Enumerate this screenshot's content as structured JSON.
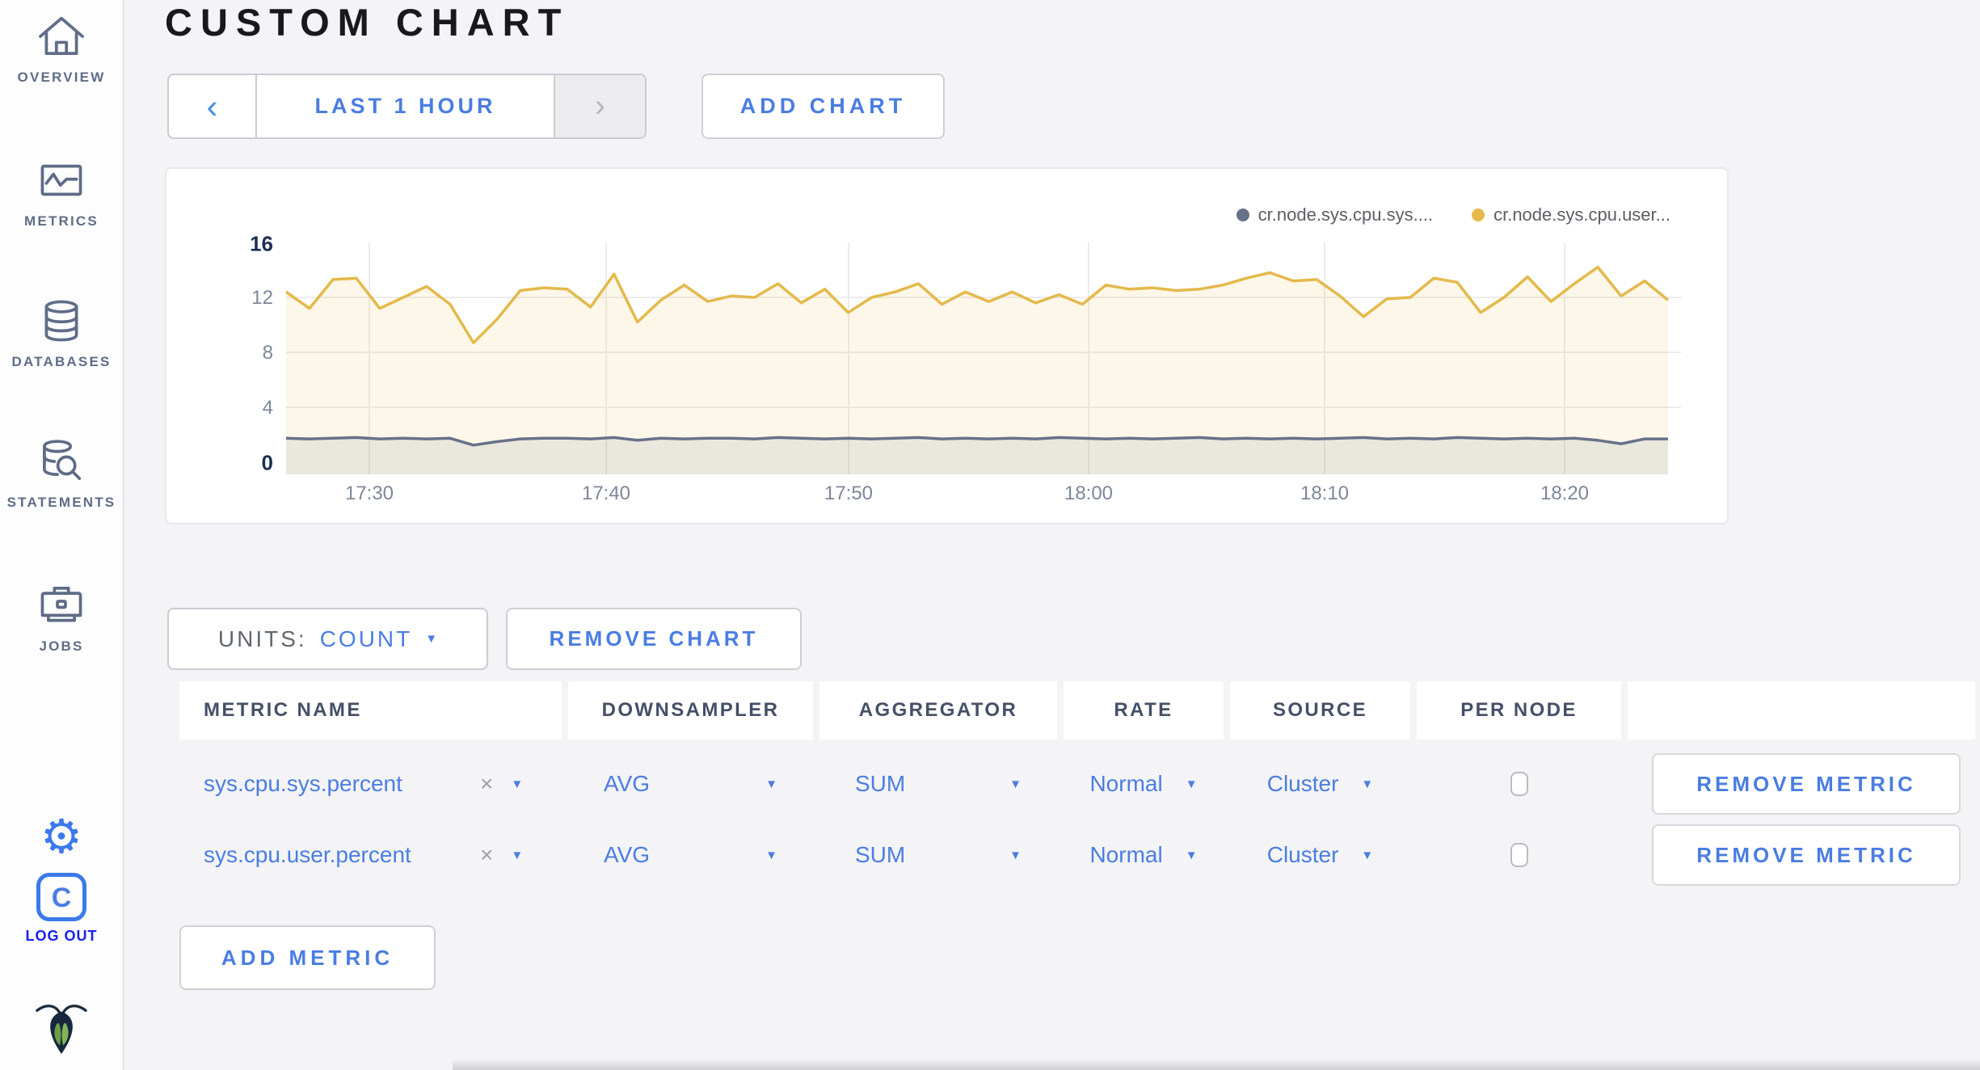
{
  "header": {
    "title": "CUSTOM CHART"
  },
  "icons": {
    "chevron_left": "‹",
    "chevron_right": "›",
    "caret_down": "▼",
    "remove_x": "×",
    "gear": "⚙",
    "logout_letter": "C"
  },
  "sidebar": {
    "items": [
      {
        "label": "OVERVIEW"
      },
      {
        "label": "METRICS"
      },
      {
        "label": "DATABASES"
      },
      {
        "label": "STATEMENTS"
      },
      {
        "label": "JOBS"
      }
    ],
    "logout_label": "LOG OUT"
  },
  "toolbar": {
    "time_window": "LAST 1 HOUR",
    "add_chart": "ADD CHART"
  },
  "chart_data": {
    "type": "area",
    "title": "",
    "grid": true,
    "legend_position": "top-right",
    "ylim": [
      0,
      16
    ],
    "y_ticks": [
      0,
      4,
      8,
      12,
      16
    ],
    "x_ticks": [
      "17:30",
      "17:40",
      "17:50",
      "18:00",
      "18:10",
      "18:20"
    ],
    "series": [
      {
        "name": "cr.node.sys.cpu.sys....",
        "color": "#66718a",
        "fill": "rgba(108,118,137,0.12)",
        "values": [
          1.75,
          1.7,
          1.75,
          1.8,
          1.7,
          1.75,
          1.7,
          1.75,
          1.25,
          1.5,
          1.7,
          1.75,
          1.75,
          1.7,
          1.8,
          1.6,
          1.75,
          1.7,
          1.75,
          1.75,
          1.7,
          1.8,
          1.75,
          1.7,
          1.75,
          1.7,
          1.75,
          1.8,
          1.7,
          1.75,
          1.7,
          1.75,
          1.7,
          1.8,
          1.75,
          1.7,
          1.75,
          1.7,
          1.75,
          1.8,
          1.7,
          1.75,
          1.7,
          1.75,
          1.7,
          1.75,
          1.8,
          1.7,
          1.75,
          1.7,
          1.8,
          1.75,
          1.7,
          1.75,
          1.7,
          1.75,
          1.6,
          1.35,
          1.7,
          1.7
        ]
      },
      {
        "name": "cr.node.sys.cpu.user...",
        "color": "#e4b94b",
        "fill": "rgba(232,192,80,0.13)",
        "values": [
          12.4,
          11.2,
          13.3,
          13.4,
          11.2,
          12.0,
          12.8,
          11.5,
          8.7,
          10.4,
          12.5,
          12.7,
          12.6,
          11.3,
          13.7,
          10.2,
          11.8,
          12.9,
          11.7,
          12.1,
          12.0,
          13.0,
          11.6,
          12.6,
          10.9,
          12.0,
          12.4,
          13.0,
          11.5,
          12.4,
          11.7,
          12.4,
          11.6,
          12.2,
          11.5,
          12.9,
          12.6,
          12.7,
          12.5,
          12.6,
          12.9,
          13.4,
          13.8,
          13.2,
          13.3,
          12.1,
          10.6,
          11.9,
          12.0,
          13.4,
          13.1,
          10.9,
          12.0,
          13.5,
          11.7,
          13.0,
          14.2,
          12.1,
          13.2,
          11.8
        ]
      }
    ]
  },
  "chart_controls": {
    "units_label": "UNITS:",
    "units_value": "COUNT",
    "remove_chart": "REMOVE CHART"
  },
  "metrics_table": {
    "columns": [
      "METRIC NAME",
      "DOWNSAMPLER",
      "AGGREGATOR",
      "RATE",
      "SOURCE",
      "PER NODE",
      ""
    ],
    "rows": [
      {
        "metric": "sys.cpu.sys.percent",
        "downsampler": "AVG",
        "aggregator": "SUM",
        "rate": "Normal",
        "source": "Cluster",
        "per_node_checked": false,
        "remove_label": "REMOVE METRIC"
      },
      {
        "metric": "sys.cpu.user.percent",
        "downsampler": "AVG",
        "aggregator": "SUM",
        "rate": "Normal",
        "source": "Cluster",
        "per_node_checked": false,
        "remove_label": "REMOVE METRIC"
      }
    ],
    "add_metric_label": "ADD METRIC"
  }
}
